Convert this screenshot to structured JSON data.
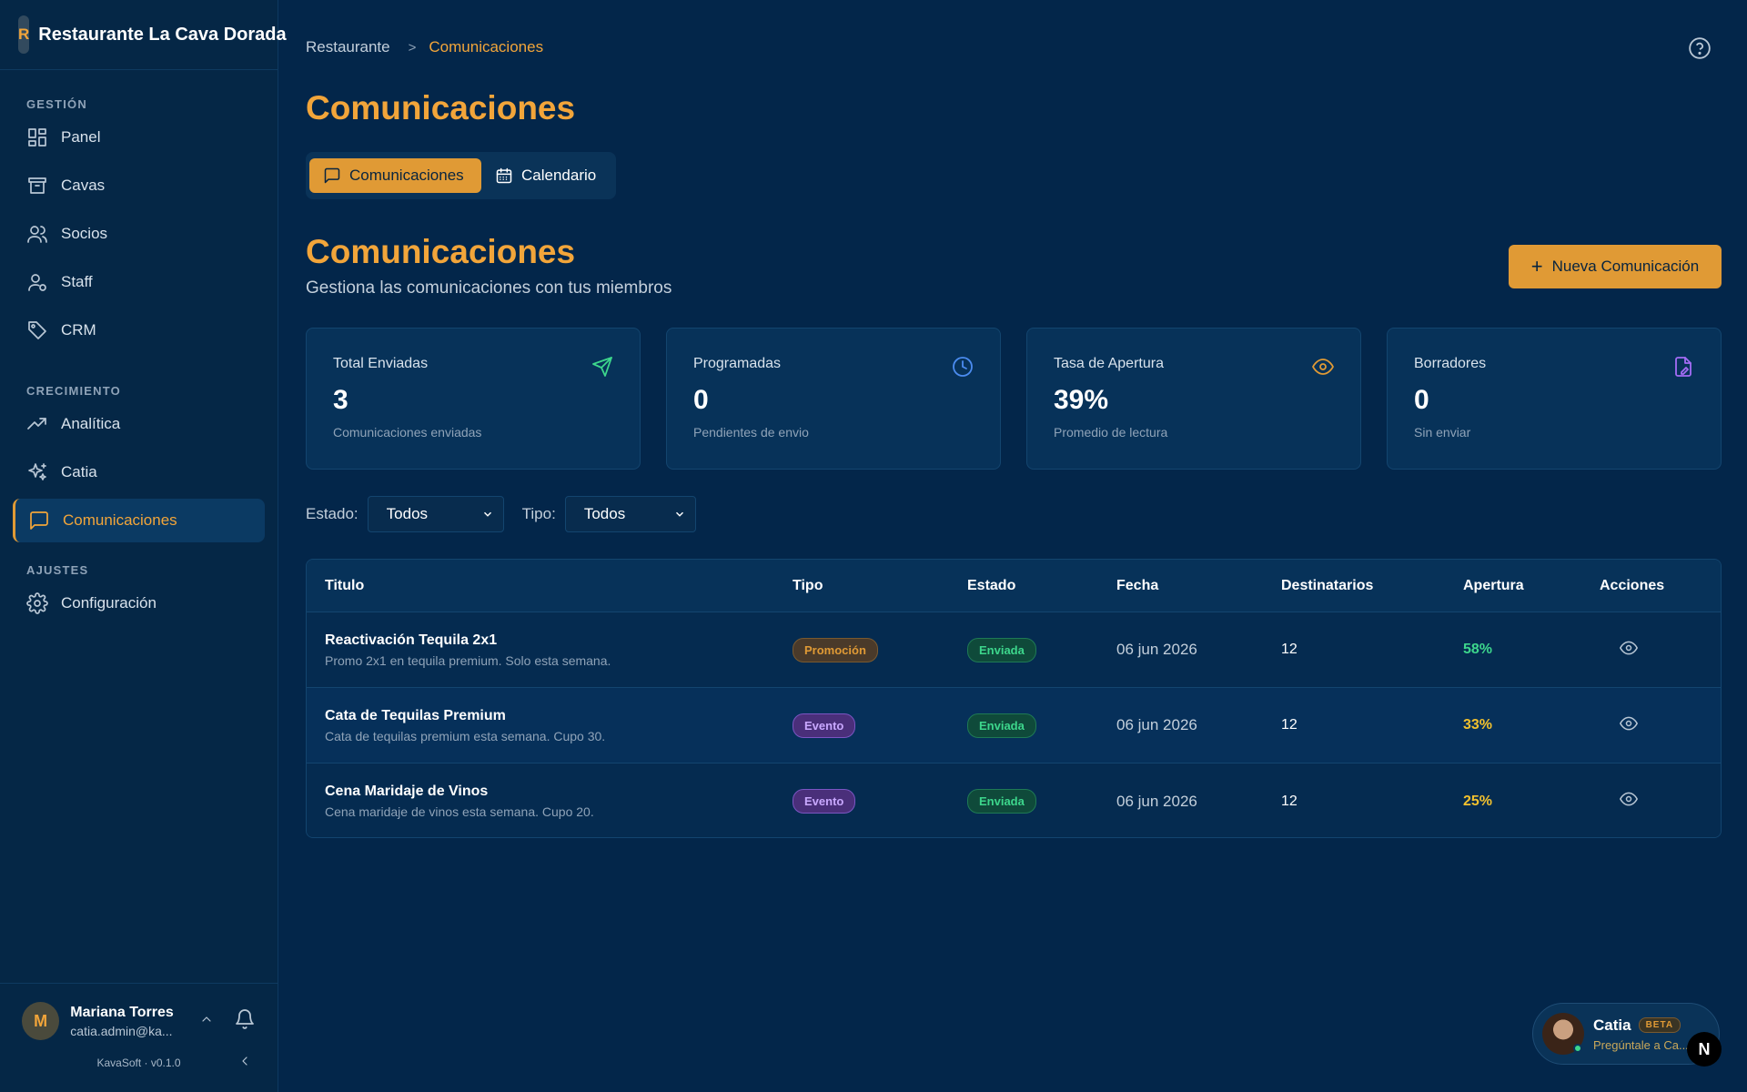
{
  "app": {
    "brand_initial": "R",
    "brand_name": "Restaurante La Cava Dorada"
  },
  "sidebar": {
    "sections": [
      {
        "heading": "GESTIÓN",
        "items": [
          {
            "label": "Panel",
            "icon": "grid-icon"
          },
          {
            "label": "Cavas",
            "icon": "archive-icon"
          },
          {
            "label": "Socios",
            "icon": "users-icon"
          },
          {
            "label": "Staff",
            "icon": "user-cog-icon"
          },
          {
            "label": "CRM",
            "icon": "tag-icon"
          }
        ]
      },
      {
        "heading": "CRECIMIENTO",
        "items": [
          {
            "label": "Analítica",
            "icon": "trend-up-icon"
          },
          {
            "label": "Catia",
            "icon": "sparkles-icon"
          },
          {
            "label": "Comunicaciones",
            "icon": "message-square-icon",
            "active": true
          }
        ]
      },
      {
        "heading": "AJUSTES",
        "items": [
          {
            "label": "Configuración",
            "icon": "gear-icon"
          }
        ]
      }
    ],
    "user": {
      "initial": "M",
      "name": "Mariana Torres",
      "email": "catia.admin@ka..."
    },
    "version": "KavaSoft · v0.1.0"
  },
  "breadcrumb": {
    "root": "Restaurante",
    "separator": ">",
    "current": "Comunicaciones"
  },
  "page": {
    "title": "Comunicaciones",
    "tabs": [
      {
        "label": "Comunicaciones",
        "icon": "message-square-icon",
        "active": true
      },
      {
        "label": "Calendario",
        "icon": "calendar-icon",
        "active": false
      }
    ],
    "section_title": "Comunicaciones",
    "section_subtitle": "Gestiona las comunicaciones con tus miembros",
    "new_button": {
      "plus": "+",
      "label": "Nueva Comunicación"
    }
  },
  "stats": [
    {
      "label": "Total Enviadas",
      "value": "3",
      "note": "Comunicaciones enviadas",
      "icon": "send-icon",
      "color": "#3dd68c"
    },
    {
      "label": "Programadas",
      "value": "0",
      "note": "Pendientes de envio",
      "icon": "clock-icon",
      "color": "#4b8cf0"
    },
    {
      "label": "Tasa de Apertura",
      "value": "39%",
      "note": "Promedio de lectura",
      "icon": "eye-icon",
      "color": "#e09a35"
    },
    {
      "label": "Borradores",
      "value": "0",
      "note": "Sin enviar",
      "icon": "file-edit-icon",
      "color": "#a46cf5"
    }
  ],
  "filters": {
    "estado_label": "Estado:",
    "estado_value": "Todos",
    "tipo_label": "Tipo:",
    "tipo_value": "Todos"
  },
  "table": {
    "headers": [
      "Titulo",
      "Tipo",
      "Estado",
      "Fecha",
      "Destinatarios",
      "Apertura",
      "Acciones"
    ],
    "rows": [
      {
        "title": "Reactivación Tequila 2x1",
        "desc": "Promo 2x1 en tequila premium. Solo esta semana.",
        "tipo": "Promoción",
        "tipo_style": "promo",
        "estado": "Enviada",
        "fecha": "06 jun 2026",
        "destinatarios": "12",
        "apertura": "58%",
        "apertura_color": "#3dd68c"
      },
      {
        "title": "Cata de Tequilas Premium",
        "desc": "Cata de tequilas premium esta semana. Cupo 30.",
        "tipo": "Evento",
        "tipo_style": "evento",
        "estado": "Enviada",
        "fecha": "06 jun 2026",
        "destinatarios": "12",
        "apertura": "33%",
        "apertura_color": "#f2c12e"
      },
      {
        "title": "Cena Maridaje de Vinos",
        "desc": "Cena maridaje de vinos esta semana. Cupo 20.",
        "tipo": "Evento",
        "tipo_style": "evento",
        "estado": "Enviada",
        "fecha": "06 jun 2026",
        "destinatarios": "12",
        "apertura": "25%",
        "apertura_color": "#f2c12e"
      }
    ]
  },
  "assistant": {
    "name": "Catia",
    "badge": "BETA",
    "subtitle": "Pregúntale a Ca..."
  },
  "corner_badge": "N"
}
